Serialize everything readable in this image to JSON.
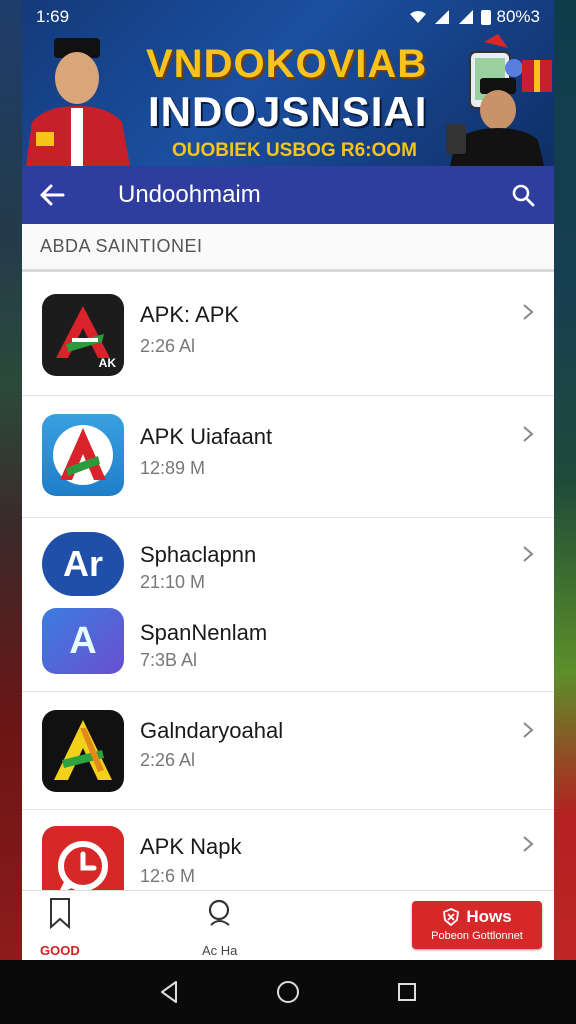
{
  "status_bar": {
    "time": "1:69",
    "battery": "80%3"
  },
  "banner": {
    "title_line1": "VNDOKOVIAB",
    "title_line2": "INDOJSNSIAI",
    "subtitle": "OUOBIEK USBOG R6:OOM"
  },
  "app_bar": {
    "title": "Undoohmaim"
  },
  "section": {
    "label": "ABDA SAINTIONEI"
  },
  "apps": [
    {
      "name": "APK: APK",
      "time": "2:26 Al",
      "chevron": true,
      "icon": "apk-triangle-dark-icon",
      "icon_label": "AK"
    },
    {
      "name": "APK Uiafaant",
      "time": "12:89 M",
      "chevron": true,
      "icon": "apk-triangle-blue-icon"
    },
    {
      "name": "Sphaclapnn",
      "time": "21:10 M",
      "chevron": true,
      "icon": "ar-blue-circle-icon",
      "icon_label": "Ar"
    },
    {
      "name": "SpanNenlam",
      "time": "7:3B Al",
      "chevron": false,
      "icon": "a-gradient-icon",
      "icon_label": "A"
    },
    {
      "name": "Galndaryoahal",
      "time": "2:26 Al",
      "chevron": true,
      "icon": "a-green-yellow-icon"
    },
    {
      "name": "APK Napk",
      "time": "12:6 M",
      "chevron": true,
      "icon": "clock-red-icon"
    }
  ],
  "bottom_nav": {
    "item1_label": "GOOD",
    "item2_label": "Ac Ha",
    "cta_line1": "Hows",
    "cta_line2": "Pobeon Gottlonnet"
  },
  "colors": {
    "app_bar": "#2f3e9e",
    "cta": "#d62828",
    "banner": "#1b4fa0"
  }
}
